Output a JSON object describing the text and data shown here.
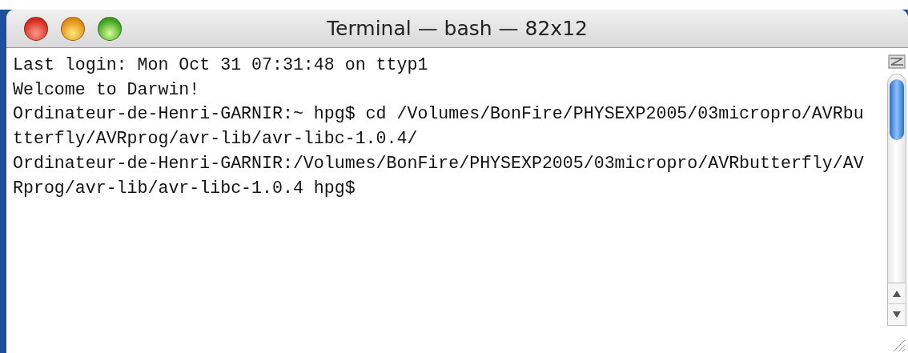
{
  "window": {
    "title": "Terminal — bash — 82x12"
  },
  "terminal": {
    "lines": [
      "Last login: Mon Oct 31 07:31:48 on ttyp1",
      "Welcome to Darwin!",
      "Ordinateur-de-Henri-GARNIR:~ hpg$ cd /Volumes/BonFire/PHYSEXP2005/03micropro/AVRbu",
      "tterfly/AVRprog/avr-lib/avr-libc-1.0.4/",
      "Ordinateur-de-Henri-GARNIR:/Volumes/BonFire/PHYSEXP2005/03micropro/AVRbutterfly/AV",
      "Rprog/avr-lib/avr-libc-1.0.4 hpg$"
    ]
  }
}
